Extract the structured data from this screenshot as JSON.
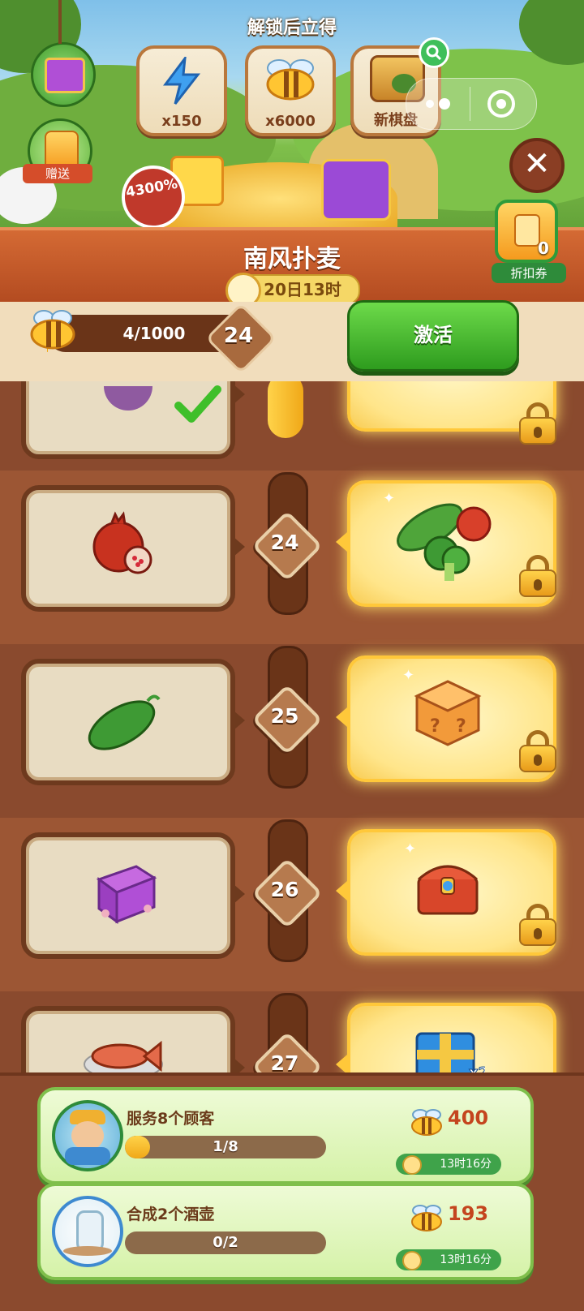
{
  "banner": {
    "title": "解锁后立得",
    "rewards": [
      {
        "label": "x150",
        "icon": "blue-energy-bolt-icon"
      },
      {
        "label": "x6000",
        "icon": "bee-coin-icon"
      },
      {
        "label": "新棋盘",
        "icon": "new-board-icon"
      }
    ],
    "gift_label": "赠送",
    "discount_badge": "4300%",
    "coupon_count": "0",
    "coupon_label": "折扣券"
  },
  "event": {
    "name": "南风扑麦",
    "time_left": "20日13时"
  },
  "progress": {
    "text": "4/1000",
    "level": "24",
    "activate_label": "激活"
  },
  "track": {
    "rows": [
      {
        "level": "",
        "free": "completed-item",
        "premium": "locked-reward",
        "free_claimed": true
      },
      {
        "level": "24",
        "free": "pomegranate-icon",
        "premium": "vegetables-bundle-icon"
      },
      {
        "level": "25",
        "free": "cucumber-icon",
        "premium": "mystery-cube-icon"
      },
      {
        "level": "26",
        "free": "purple-chest-icon",
        "premium": "treasure-chest-icon"
      },
      {
        "level": "27",
        "free": "fish-dish-icon",
        "premium": "blue-gift-box-icon"
      }
    ]
  },
  "quests": [
    {
      "title": "服务8个顾客",
      "progress_text": "1/8",
      "progress": 0.125,
      "reward": "400",
      "time": "13时16分",
      "avatar": "farmer-icon"
    },
    {
      "title": "合成2个酒壶",
      "progress_text": "0/2",
      "progress": 0,
      "reward": "193",
      "time": "13时16分",
      "avatar": "wine-jug-icon"
    }
  ],
  "colors": {
    "accent_green": "#2e9c1e",
    "ribbon": "#c0552a",
    "gold": "#f0a818"
  }
}
